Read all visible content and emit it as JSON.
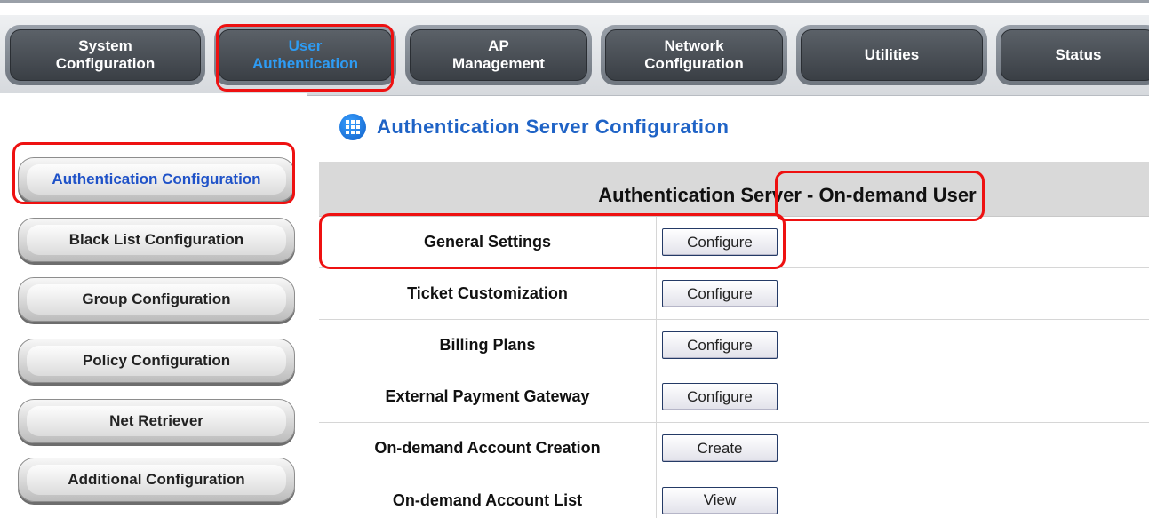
{
  "nav": {
    "tabs": [
      {
        "label": "System\nConfiguration"
      },
      {
        "label": "User\nAuthentication"
      },
      {
        "label": "AP\nManagement"
      },
      {
        "label": "Network\nConfiguration"
      },
      {
        "label": "Utilities"
      },
      {
        "label": "Status"
      }
    ]
  },
  "sidebar": {
    "items": [
      {
        "label": "Authentication Configuration"
      },
      {
        "label": "Black List Configuration"
      },
      {
        "label": "Group Configuration"
      },
      {
        "label": "Policy Configuration"
      },
      {
        "label": "Net Retriever"
      },
      {
        "label": "Additional Configuration"
      }
    ]
  },
  "main": {
    "title": "Authentication Server Configuration",
    "table_header_prefix": "Authentication Server - ",
    "table_header_suffix": "On-demand User",
    "rows": [
      {
        "label": "General Settings",
        "action": "Configure"
      },
      {
        "label": "Ticket Customization",
        "action": "Configure"
      },
      {
        "label": "Billing Plans",
        "action": "Configure"
      },
      {
        "label": "External Payment Gateway",
        "action": "Configure"
      },
      {
        "label": "On-demand Account Creation",
        "action": "Create"
      },
      {
        "label": "On-demand Account List",
        "action": "View"
      }
    ]
  },
  "colors": {
    "highlight": "#ee1111",
    "active_tab_text": "#2e9cf4",
    "title_blue": "#1f63c6"
  }
}
